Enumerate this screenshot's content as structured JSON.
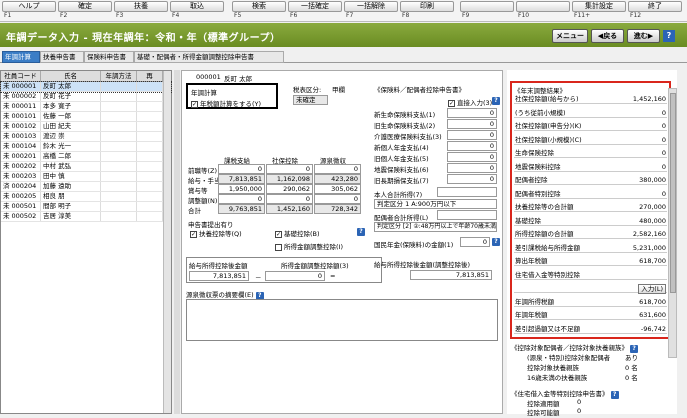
{
  "fkeys": [
    {
      "label": "ヘルプ",
      "num": "F1"
    },
    {
      "label": "確定",
      "num": "F2"
    },
    {
      "label": "扶養",
      "num": "F3"
    },
    {
      "label": "取込",
      "num": "F4"
    },
    {
      "label": "検索",
      "num": "F5"
    },
    {
      "label": "一括確定",
      "num": "F6"
    },
    {
      "label": "一括解除",
      "num": "F7"
    },
    {
      "label": "印刷",
      "num": "F8"
    },
    {
      "label": "",
      "num": "F9"
    },
    {
      "label": "",
      "num": "F10"
    },
    {
      "label": "集計設定",
      "num": "F11+"
    },
    {
      "label": "終了",
      "num": "F12"
    }
  ],
  "header": {
    "title": "年調データ入力 - 現在年調年：令和・年（標準グループ）",
    "menu": "メニュー",
    "back": "戻る",
    "next": "進む"
  },
  "tabs": [
    "年調計算",
    "扶養申告書",
    "保険料申告書",
    "基礎・配偶者・所得金額調整控除申告書"
  ],
  "employee_list": {
    "columns": [
      "社員コード",
      "氏名",
      "年調方法",
      "再"
    ],
    "rows": [
      {
        "status": "未",
        "code": "000001",
        "name": "反町 太郎"
      },
      {
        "status": "未",
        "code": "000002",
        "name": "反町 花子"
      },
      {
        "status": "未",
        "code": "000011",
        "name": "本多 寛子"
      },
      {
        "status": "未",
        "code": "000101",
        "name": "佐藤 一郎"
      },
      {
        "status": "未",
        "code": "000102",
        "name": "山田 紀夫"
      },
      {
        "status": "未",
        "code": "000103",
        "name": "渡辺 崇"
      },
      {
        "status": "未",
        "code": "000104",
        "name": "鈴木 光一"
      },
      {
        "status": "未",
        "code": "000201",
        "name": "高橋 二郎"
      },
      {
        "status": "未",
        "code": "000202",
        "name": "中村 武弘"
      },
      {
        "status": "未",
        "code": "000203",
        "name": "田中 慎"
      },
      {
        "status": "済",
        "code": "000204",
        "name": "加藤 遠助"
      },
      {
        "status": "未",
        "code": "000205",
        "name": "相良 朋"
      },
      {
        "status": "未",
        "code": "000501",
        "name": "間部 明子"
      },
      {
        "status": "未",
        "code": "000502",
        "name": "吉居 淳美"
      }
    ]
  },
  "employee": {
    "code": "000001",
    "name": "反町 太郎",
    "tax_label": "税表区分:",
    "tax_value": "甲欄",
    "status": "未確定"
  },
  "nencho": {
    "label": "年調計算",
    "check_label": "年税額計算をする(Y)",
    "checked": true
  },
  "pay_table": {
    "cols": [
      "課税支給",
      "社保控除",
      "源泉徴収"
    ],
    "rows": [
      {
        "label": "前職等(Z)",
        "v": [
          "0",
          "0",
          "0"
        ]
      },
      {
        "label": "給与・手当",
        "v": [
          "7,813,851",
          "1,162,098",
          "423,280"
        ]
      },
      {
        "label": "賞与等",
        "v": [
          "1,950,000",
          "290,062",
          "305,062"
        ]
      },
      {
        "label": "調整額(N)",
        "v": [
          "0",
          "0",
          "0"
        ]
      },
      {
        "label": "合計",
        "v": [
          "9,763,851",
          "1,452,160",
          "728,342"
        ]
      }
    ]
  },
  "shinkoku": {
    "label": "申告書提出有り",
    "fuyo": "扶養控除等(Q)",
    "kiso": "基礎控除(B)",
    "shotoku": "所得金額調整控除(I)"
  },
  "income_calc": {
    "label1": "給与所得控除後金額",
    "label2": "所得金額調整控除額(3)",
    "label3": "給与所得控除後金額(調整控除後)",
    "v1": "7,813,851",
    "v2": "0",
    "v3": "7,813,851",
    "minus": "－",
    "eq": "="
  },
  "tekiyo": {
    "label": "源泉徴収票の摘要欄(E)"
  },
  "insurance": {
    "title": "《保険料／配偶者控除申告書》",
    "direct": "直接入力(3)",
    "items": [
      {
        "label": "新生命保険料支払(1)",
        "v": "0"
      },
      {
        "label": "旧生命保険料支払(2)",
        "v": "0"
      },
      {
        "label": "介護医療保険料支払(3)",
        "v": "0"
      },
      {
        "label": "新個人年金支払(4)",
        "v": "0"
      },
      {
        "label": "旧個人年金支払(5)",
        "v": "0"
      },
      {
        "label": "地震保険料支払(6)",
        "v": "0"
      },
      {
        "label": "旧長期損保支払(7)",
        "v": "0"
      }
    ],
    "honnin": "本人合計所得(7)",
    "hantei1": "判定区分 1 A:900万円以下",
    "haigu": "配偶者合計所得(L)",
    "hantei2": "判定区分 [2] ②:48万円以上で年齢70歳未満",
    "kokumin": "国民年金(保険料)の金額(1)",
    "kokumin_v": "0"
  },
  "result": {
    "title": "《年末調整結果》",
    "rows": [
      {
        "k": "社保控除額(給与から)",
        "v": "1,452,160"
      },
      {
        "k": "(うち従前小規模)",
        "v": "0"
      },
      {
        "k": "社保控除額(申告分)(K)",
        "v": "0"
      },
      {
        "k": "社保控除額(小規模)(C)",
        "v": "0"
      },
      {
        "k": "生命保険控除",
        "v": "0"
      },
      {
        "k": "地震保険料控除",
        "v": "0"
      },
      {
        "k": "配偶者控除",
        "v": "380,000"
      },
      {
        "k": "配偶者特別控除",
        "v": "0"
      },
      {
        "k": "扶養控除等の合計額",
        "v": "270,000"
      },
      {
        "k": "基礎控除",
        "v": "480,000"
      },
      {
        "k": "所得控除額の合計額",
        "v": "2,582,160"
      },
      {
        "k": "差引課税給与所得金額",
        "v": "5,231,000"
      },
      {
        "k": "算出年税額",
        "v": "618,700"
      },
      {
        "k": "住宅借入金等特別控除",
        "v": ""
      },
      {
        "k": "",
        "v": "入力(L)"
      },
      {
        "k": "年調所得税額",
        "v": "618,700"
      },
      {
        "k": "年調年税額",
        "v": "631,600"
      },
      {
        "k": "差引超過額又は不足額",
        "v": "-96,742"
      }
    ]
  },
  "fuyou_section": {
    "title": "《控除対象配偶者／控除対象扶養親族》",
    "rows": [
      {
        "k": "(源泉・特別)控除対象配偶者",
        "v": "あり"
      },
      {
        "k": "控除対象扶養親族",
        "v": "0 名"
      },
      {
        "k": "16歳未満の扶養親族",
        "v": "0 名"
      }
    ]
  },
  "jutaku_section": {
    "title": "《住宅借入金等特別控除申告書》",
    "rows": [
      {
        "k": "控除適用額",
        "v": "0"
      },
      {
        "k": "控除可能額",
        "v": "0"
      }
    ]
  }
}
